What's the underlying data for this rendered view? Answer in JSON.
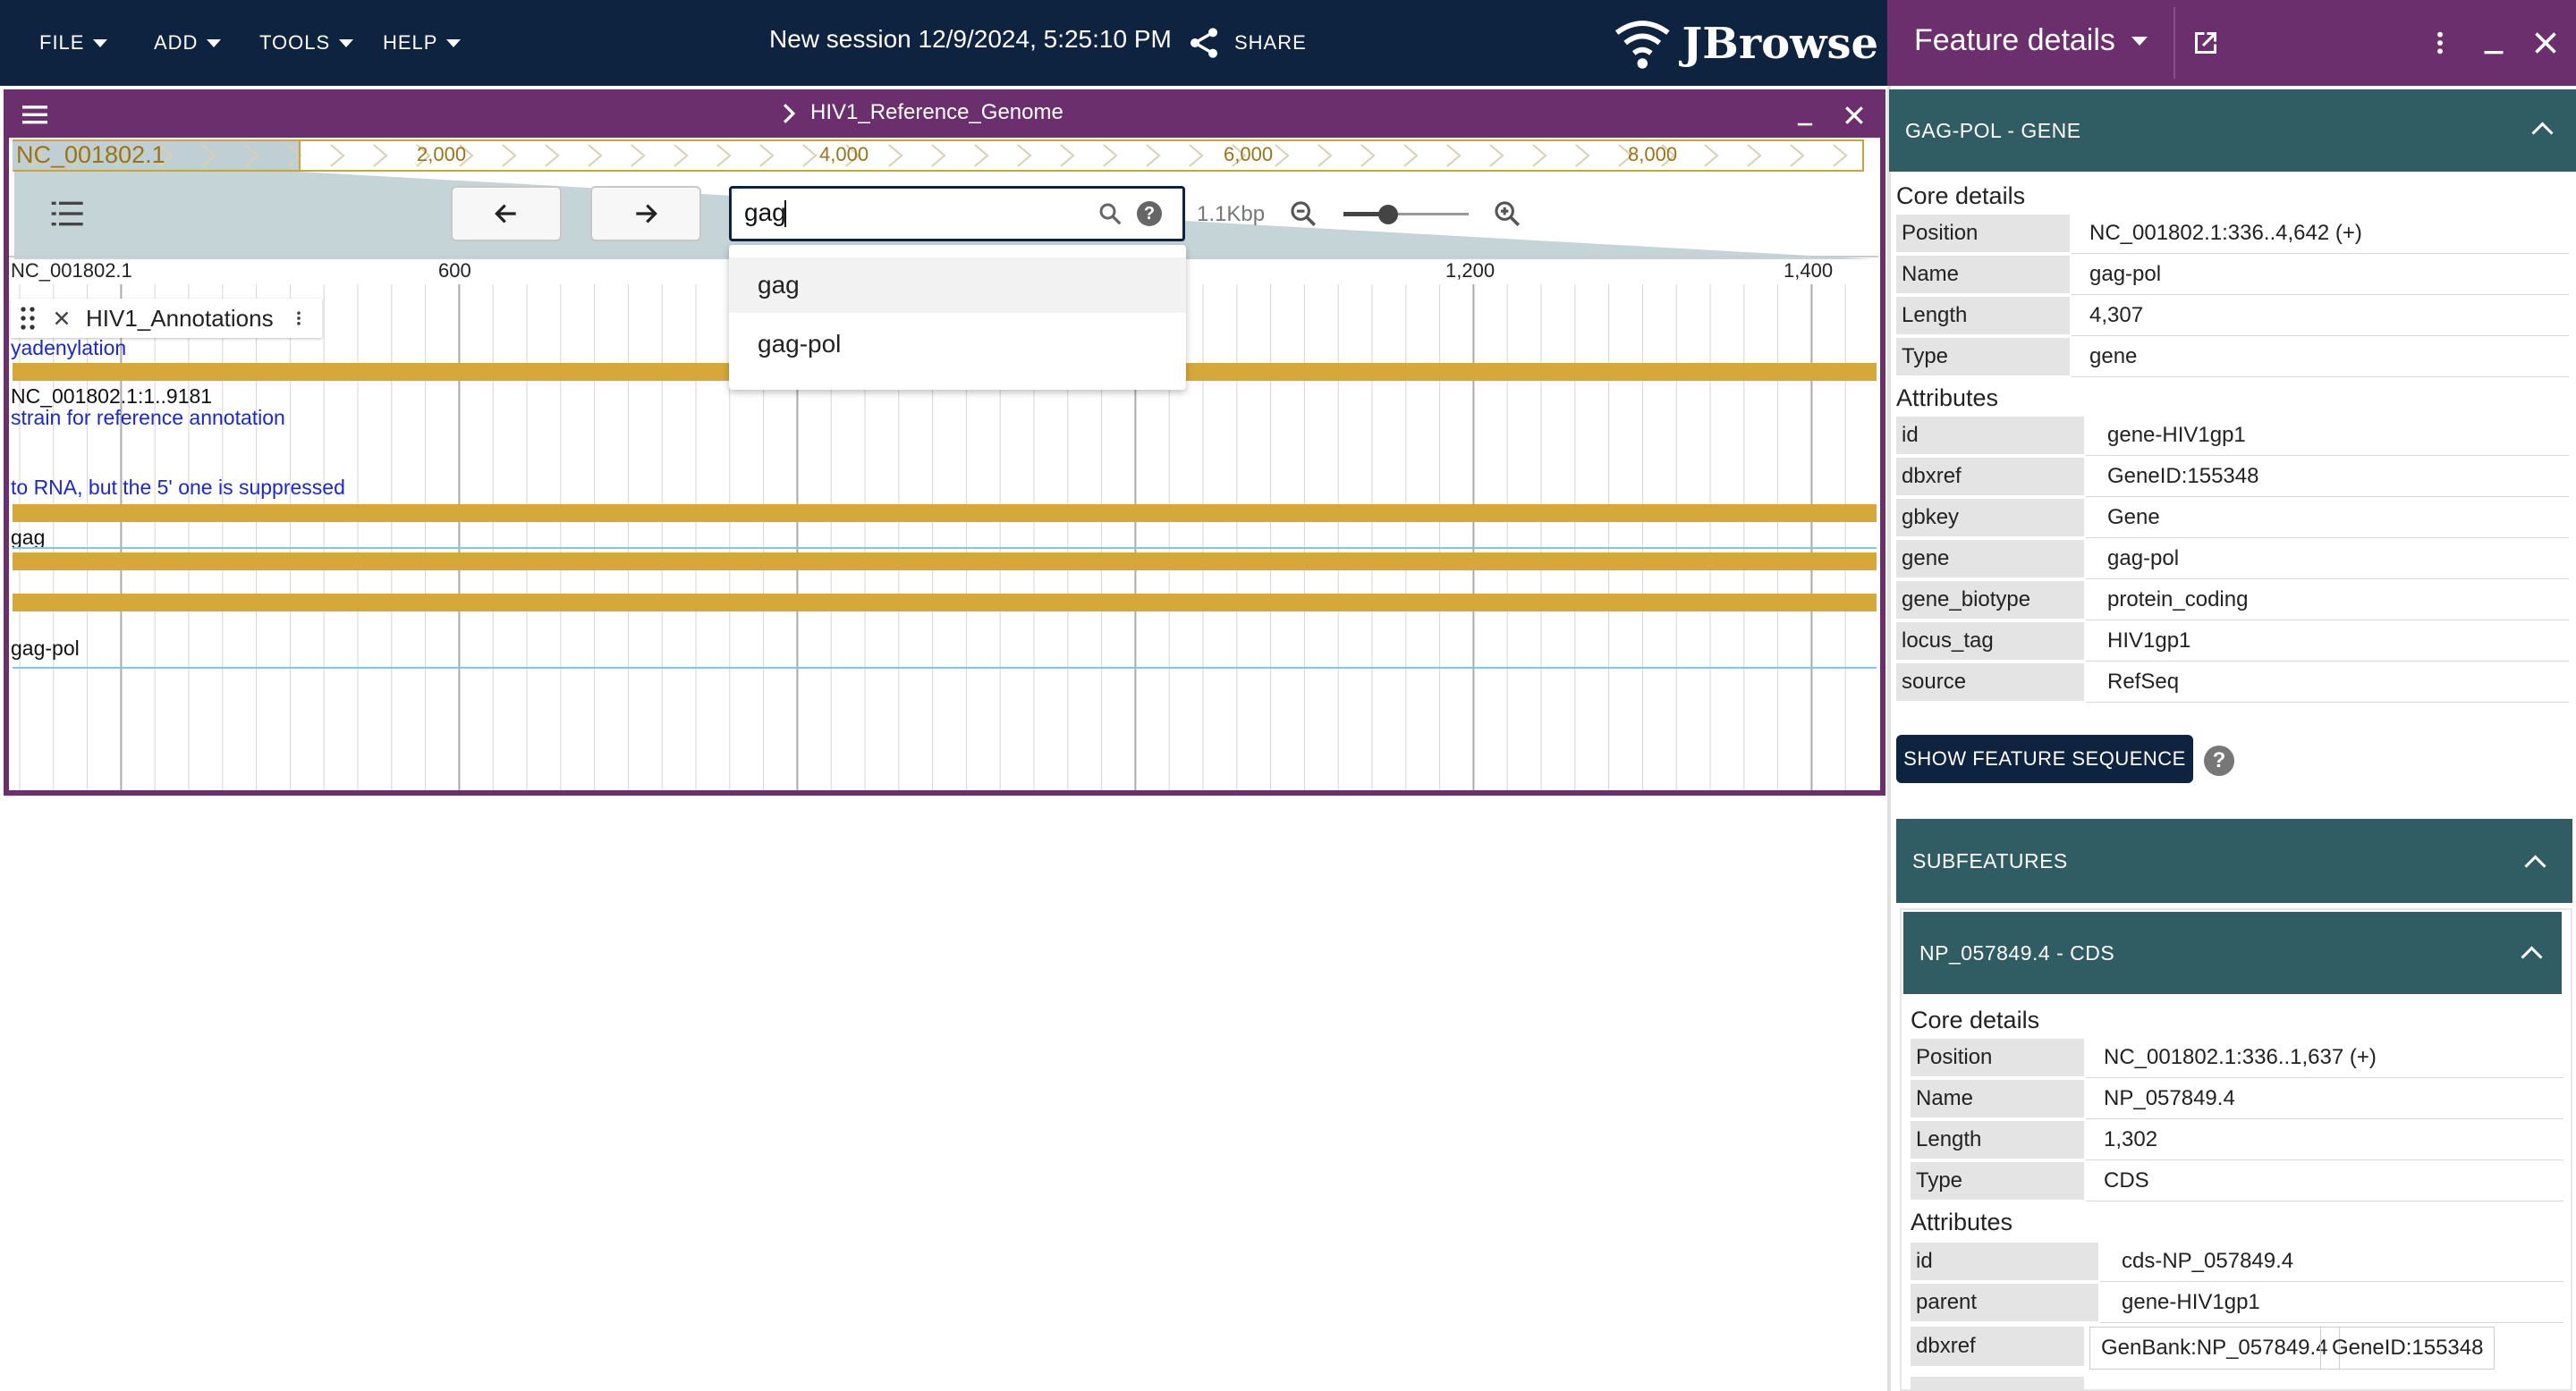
{
  "menu": [
    "FILE",
    "ADD",
    "TOOLS",
    "HELP"
  ],
  "session_title": "New session 12/9/2024, 5:25:10 PM",
  "share_label": "SHARE",
  "logo_text": "JBrowse",
  "drawer": {
    "title": "Feature details"
  },
  "view": {
    "title": "HIV1_Reference_Genome",
    "refname": "NC_001802.1",
    "overview_ticks": [
      "2,000",
      "4,000",
      "6,000",
      "8,000"
    ],
    "search_value": "gag",
    "zoom_label": "1.1Kbp",
    "ruler_refname": "NC_001802.1",
    "ruler_ticks": [
      "600",
      "1,200",
      "1,400"
    ],
    "dropdown": [
      "gag",
      "gag-pol"
    ],
    "track_name": "HIV1_Annotations",
    "features": {
      "t1": "yadenylation",
      "t2": "NC_001802.1:1..9181",
      "t3": "strain for reference annotation",
      "t4": "to RNA, but the 5' one is suppressed",
      "t5": "gag",
      "t6": "gag-pol"
    }
  },
  "panel": {
    "header": "GAG-POL - GENE",
    "core_title": "Core details",
    "core": [
      {
        "k": "Position",
        "v": "NC_001802.1:336..4,642 (+)"
      },
      {
        "k": "Name",
        "v": "gag-pol"
      },
      {
        "k": "Length",
        "v": "4,307"
      },
      {
        "k": "Type",
        "v": "gene"
      }
    ],
    "attr_title": "Attributes",
    "attrs": [
      {
        "k": "id",
        "v": "gene-HIV1gp1"
      },
      {
        "k": "dbxref",
        "v": "GeneID:155348"
      },
      {
        "k": "gbkey",
        "v": "Gene"
      },
      {
        "k": "gene",
        "v": "gag-pol"
      },
      {
        "k": "gene_biotype",
        "v": "protein_coding"
      },
      {
        "k": "locus_tag",
        "v": "HIV1gp1"
      },
      {
        "k": "source",
        "v": "RefSeq"
      }
    ],
    "seq_button": "SHOW FEATURE SEQUENCE",
    "subfeatures_header": "SUBFEATURES",
    "sub": {
      "header": "NP_057849.4 - CDS",
      "core_title": "Core details",
      "core": [
        {
          "k": "Position",
          "v": "NC_001802.1:336..1,637 (+)"
        },
        {
          "k": "Name",
          "v": "NP_057849.4"
        },
        {
          "k": "Length",
          "v": "1,302"
        },
        {
          "k": "Type",
          "v": "CDS"
        }
      ],
      "attr_title": "Attributes",
      "attrs": [
        {
          "k": "id",
          "v": "cds-NP_057849.4"
        },
        {
          "k": "parent",
          "v": "gene-HIV1gp1"
        }
      ],
      "dbxref_key": "dbxref",
      "dbxref_values": [
        "GenBank:NP_057849.4",
        "GeneID:155348"
      ]
    }
  },
  "colors": {
    "appbar": "#0d233f",
    "drawer": "#6a2f6c",
    "feature": "#d6a83a",
    "section": "#2f5d63"
  }
}
